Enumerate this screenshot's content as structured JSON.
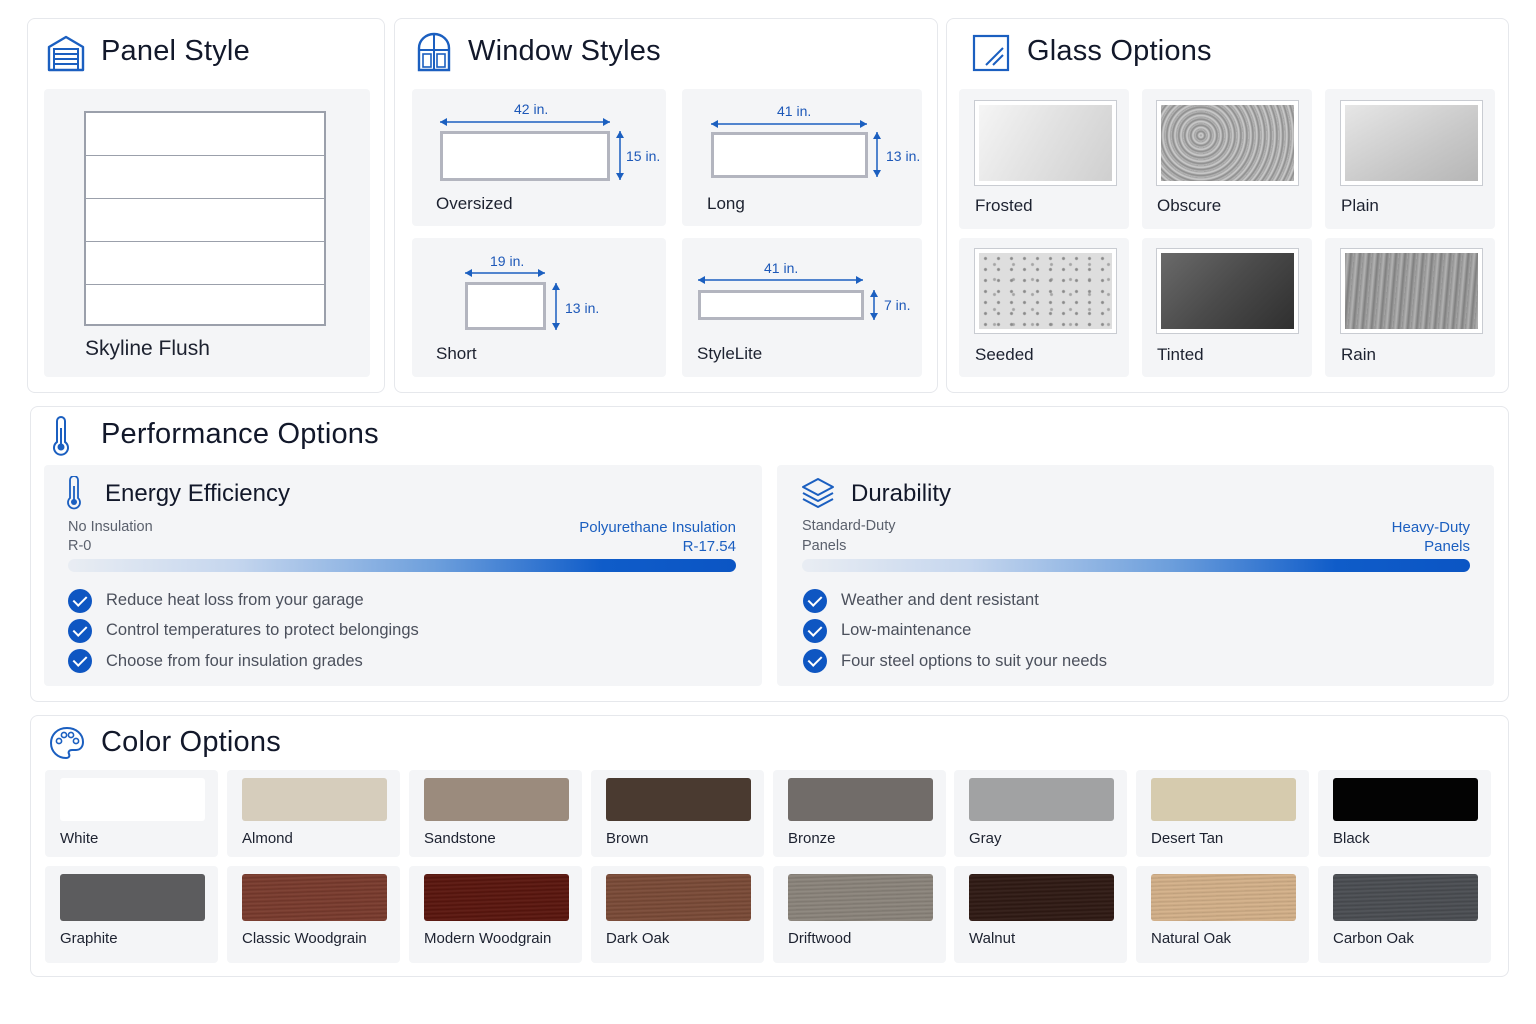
{
  "panel": {
    "title": "Panel Style",
    "style_name": "Skyline Flush",
    "icon": "garage-door-icon"
  },
  "windows": {
    "title": "Window Styles",
    "icon": "arched-window-icon",
    "items": [
      {
        "name": "Oversized",
        "width": "42 in.",
        "height": "15 in."
      },
      {
        "name": "Long",
        "width": "41 in.",
        "height": "13 in."
      },
      {
        "name": "Short",
        "width": "19 in.",
        "height": "13 in."
      },
      {
        "name": "StyleLite",
        "width": "41 in.",
        "height": "7 in."
      }
    ]
  },
  "glass": {
    "title": "Glass Options",
    "icon": "glass-pane-icon",
    "items": [
      {
        "name": "Frosted"
      },
      {
        "name": "Obscure"
      },
      {
        "name": "Plain"
      },
      {
        "name": "Seeded"
      },
      {
        "name": "Tinted"
      },
      {
        "name": "Rain"
      }
    ]
  },
  "performance": {
    "title": "Performance Options",
    "icon": "thermometer-icon",
    "energy": {
      "title": "Energy Efficiency",
      "icon": "thermometer-icon",
      "low_label": "No Insulation",
      "low_value": "R-0",
      "high_label": "Polyurethane Insulation",
      "high_value": "R-17.54",
      "features": [
        "Reduce heat loss from your garage",
        "Control temperatures to protect belongings",
        "Choose from four insulation grades"
      ]
    },
    "durability": {
      "title": "Durability",
      "icon": "layers-icon",
      "low_label": "Standard-Duty",
      "low_value": "Panels",
      "high_label": "Heavy-Duty",
      "high_value": "Panels",
      "features": [
        "Weather and dent resistant",
        "Low-maintenance",
        "Four steel options to suit your needs"
      ]
    }
  },
  "colors": {
    "title": "Color Options",
    "icon": "palette-icon",
    "items": [
      {
        "name": "White",
        "hex": "#ffffff"
      },
      {
        "name": "Almond",
        "hex": "#d6cdbc"
      },
      {
        "name": "Sandstone",
        "hex": "#9b8b7d"
      },
      {
        "name": "Brown",
        "hex": "#4a3a30"
      },
      {
        "name": "Bronze",
        "hex": "#716c69"
      },
      {
        "name": "Gray",
        "hex": "#a1a2a3"
      },
      {
        "name": "Desert Tan",
        "hex": "#d6cbae"
      },
      {
        "name": "Black",
        "hex": "#030303"
      },
      {
        "name": "Graphite",
        "hex": "#5c5c5e"
      },
      {
        "name": "Classic Woodgrain",
        "hex": "#7a3a2c"
      },
      {
        "name": "Modern Woodgrain",
        "hex": "#5a140c"
      },
      {
        "name": "Dark Oak",
        "hex": "#7b4a36"
      },
      {
        "name": "Driftwood",
        "hex": "#8c857c"
      },
      {
        "name": "Walnut",
        "hex": "#2e1812"
      },
      {
        "name": "Natural Oak",
        "hex": "#d6b28a"
      },
      {
        "name": "Carbon Oak",
        "hex": "#4a4d52"
      }
    ]
  }
}
